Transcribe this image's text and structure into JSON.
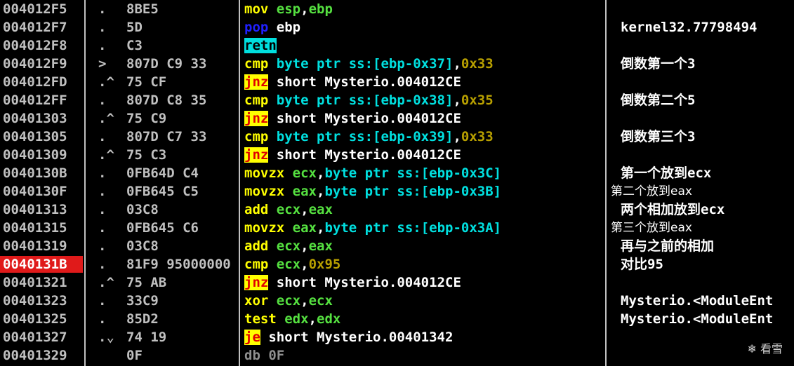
{
  "rows": [
    {
      "addr": "004012F5",
      "mark": ".",
      "hex": "8BE5",
      "mn": "mov",
      "mn_style": "yellow",
      "ops": [
        {
          "t": "esp",
          "c": "g"
        },
        {
          "t": ",",
          "c": "w"
        },
        {
          "t": "ebp",
          "c": "g"
        }
      ],
      "comment": "",
      "comment_style": "p1",
      "highlight": false
    },
    {
      "addr": "004012F7",
      "mark": ".",
      "hex": "5D",
      "mn": "pop",
      "mn_style": "blue",
      "ops": [
        {
          "t": " ebp",
          "c": "w"
        }
      ],
      "comment": "kernel32.77798494",
      "comment_style": "p1",
      "highlight": false
    },
    {
      "addr": "004012F8",
      "mark": ".",
      "hex": "C3",
      "mn": "retn",
      "mn_style": "cyanbg",
      "ops": [],
      "comment": "",
      "comment_style": "p1",
      "highlight": false
    },
    {
      "addr": "004012F9",
      "mark": ">",
      "hex": "807D C9 33",
      "mn": "cmp",
      "mn_style": "yellow",
      "ops": [
        {
          "t": "byte ptr ss:[ebp-0x37]",
          "c": "c"
        },
        {
          "t": ",",
          "c": "w"
        },
        {
          "t": "0x33",
          "c": "o"
        }
      ],
      "comment": "倒数第一个3",
      "comment_style": "p1",
      "highlight": false
    },
    {
      "addr": "004012FD",
      "mark": ".^",
      "hex": "75 CF",
      "mn": "jnz",
      "mn_style": "redbg",
      "ops": [
        {
          "t": "short Mysterio.004012CE",
          "c": "w"
        }
      ],
      "comment": "",
      "comment_style": "p1",
      "highlight": false
    },
    {
      "addr": "004012FF",
      "mark": ".",
      "hex": "807D C8 35",
      "mn": "cmp",
      "mn_style": "yellow",
      "ops": [
        {
          "t": "byte ptr ss:[ebp-0x38]",
          "c": "c"
        },
        {
          "t": ",",
          "c": "w"
        },
        {
          "t": "0x35",
          "c": "o"
        }
      ],
      "comment": "倒数第二个5",
      "comment_style": "p1",
      "highlight": false
    },
    {
      "addr": "00401303",
      "mark": ".^",
      "hex": "75 C9",
      "mn": "jnz",
      "mn_style": "redbg",
      "ops": [
        {
          "t": "short Mysterio.004012CE",
          "c": "w"
        }
      ],
      "comment": "",
      "comment_style": "p1",
      "highlight": false
    },
    {
      "addr": "00401305",
      "mark": ".",
      "hex": "807D C7 33",
      "mn": "cmp",
      "mn_style": "yellow",
      "ops": [
        {
          "t": "byte ptr ss:[ebp-0x39]",
          "c": "c"
        },
        {
          "t": ",",
          "c": "w"
        },
        {
          "t": "0x33",
          "c": "o"
        }
      ],
      "comment": "倒数第三个3",
      "comment_style": "p1",
      "highlight": false
    },
    {
      "addr": "00401309",
      "mark": ".^",
      "hex": "75 C3",
      "mn": "jnz",
      "mn_style": "redbg",
      "ops": [
        {
          "t": "short Mysterio.004012CE",
          "c": "w"
        }
      ],
      "comment": "",
      "comment_style": "p1",
      "highlight": false
    },
    {
      "addr": "0040130B",
      "mark": ".",
      "hex": "0FB64D C4",
      "mn": "movzx",
      "mn_style": "yellow",
      "ops": [
        {
          "t": "ecx",
          "c": "g"
        },
        {
          "t": ",",
          "c": "w"
        },
        {
          "t": "byte ptr ss:[ebp-0x3C]",
          "c": "c"
        }
      ],
      "comment": "第一个放到ecx",
      "comment_style": "p1",
      "highlight": false
    },
    {
      "addr": "0040130F",
      "mark": ".",
      "hex": "0FB645 C5",
      "mn": "movzx",
      "mn_style": "yellow",
      "ops": [
        {
          "t": "eax",
          "c": "g"
        },
        {
          "t": ",",
          "c": "w"
        },
        {
          "t": "byte ptr ss:[ebp-0x3B]",
          "c": "c"
        }
      ],
      "comment": "第二个放到eax",
      "comment_style": "p0",
      "highlight": false
    },
    {
      "addr": "00401313",
      "mark": ".",
      "hex": "03C8",
      "mn": "add",
      "mn_style": "yellow",
      "ops": [
        {
          "t": "ecx",
          "c": "g"
        },
        {
          "t": ",",
          "c": "w"
        },
        {
          "t": "eax",
          "c": "g"
        }
      ],
      "comment": "两个相加放到ecx",
      "comment_style": "p1",
      "highlight": false
    },
    {
      "addr": "00401315",
      "mark": ".",
      "hex": "0FB645 C6",
      "mn": "movzx",
      "mn_style": "yellow",
      "ops": [
        {
          "t": "eax",
          "c": "g"
        },
        {
          "t": ",",
          "c": "w"
        },
        {
          "t": "byte ptr ss:[ebp-0x3A]",
          "c": "c"
        }
      ],
      "comment": "第三个放到eax",
      "comment_style": "p0",
      "highlight": false
    },
    {
      "addr": "00401319",
      "mark": ".",
      "hex": "03C8",
      "mn": "add",
      "mn_style": "yellow",
      "ops": [
        {
          "t": "ecx",
          "c": "g"
        },
        {
          "t": ",",
          "c": "w"
        },
        {
          "t": "eax",
          "c": "g"
        }
      ],
      "comment": "再与之前的相加",
      "comment_style": "p1",
      "highlight": false
    },
    {
      "addr": "0040131B",
      "mark": ".",
      "hex": "81F9 95000000",
      "mn": "cmp",
      "mn_style": "yellow",
      "ops": [
        {
          "t": "ecx",
          "c": "g"
        },
        {
          "t": ",",
          "c": "w"
        },
        {
          "t": "0x95",
          "c": "o"
        }
      ],
      "comment": "对比95",
      "comment_style": "p1",
      "highlight": true
    },
    {
      "addr": "00401321",
      "mark": ".^",
      "hex": "75 AB",
      "mn": "jnz",
      "mn_style": "redbg",
      "ops": [
        {
          "t": "short Mysterio.004012CE",
          "c": "w"
        }
      ],
      "comment": "",
      "comment_style": "p1",
      "highlight": false
    },
    {
      "addr": "00401323",
      "mark": ".",
      "hex": "33C9",
      "mn": "xor",
      "mn_style": "yellow",
      "ops": [
        {
          "t": "ecx",
          "c": "g"
        },
        {
          "t": ",",
          "c": "w"
        },
        {
          "t": "ecx",
          "c": "g"
        }
      ],
      "comment": "Mysterio.<ModuleEnt",
      "comment_style": "p1",
      "highlight": false
    },
    {
      "addr": "00401325",
      "mark": ".",
      "hex": "85D2",
      "mn": "test",
      "mn_style": "yellow",
      "ops": [
        {
          "t": "edx",
          "c": "g"
        },
        {
          "t": ",",
          "c": "w"
        },
        {
          "t": "edx",
          "c": "g"
        }
      ],
      "comment": "Mysterio.<ModuleEnt",
      "comment_style": "p1",
      "highlight": false
    },
    {
      "addr": "00401327",
      "mark": ".⌄",
      "hex": "74 19",
      "mn": "je",
      "mn_style": "redbg",
      "ops": [
        {
          "t": "short Mysterio.00401342",
          "c": "w"
        }
      ],
      "comment": "",
      "comment_style": "p1",
      "highlight": false
    },
    {
      "addr": "00401329",
      "mark": "",
      "hex": "0F",
      "mn": "db",
      "mn_style": "gray",
      "ops": [
        {
          "t": "0F",
          "c": "db"
        }
      ],
      "comment": "",
      "comment_style": "p1",
      "highlight": false
    }
  ],
  "watermark": {
    "icon": "snowflake-icon",
    "text": "看雪"
  },
  "colors": {
    "background": "#000000",
    "selected_address": "#e01a1a",
    "register": "#55e040",
    "memory_operand": "#00e0e0",
    "immediate": "#b8a000",
    "mnemonic": "#ffff00"
  }
}
